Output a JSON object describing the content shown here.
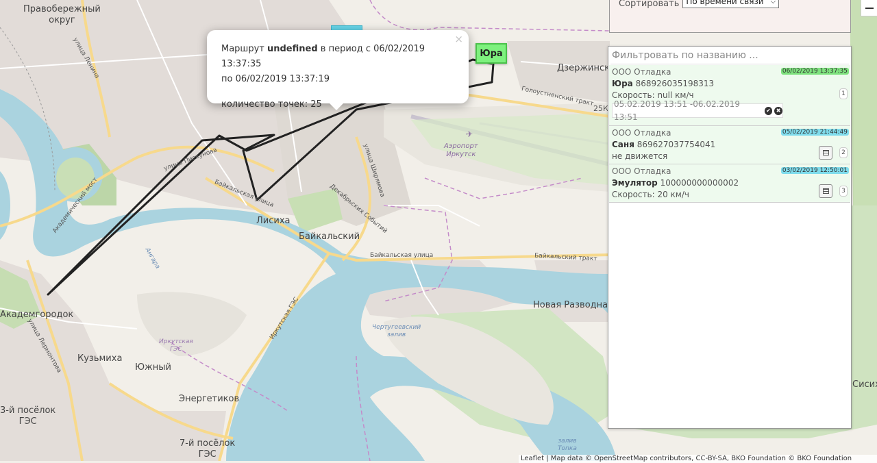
{
  "map": {
    "labels": {
      "pravoberezhny": "Правобережный\nокруг",
      "dzerzhinsk": "Дзержинск",
      "lisikha": "Лисиха",
      "baikalsky": "Байкальский",
      "akademgorodok": "Академгородок",
      "kuzmikha": "Кузьмиха",
      "yuzhny": "Южный",
      "energetikov": "Энергетиков",
      "poselok3": "3-й посёлок\nГЭС",
      "poselok7": "7-й посёлок\nГЭС",
      "novaya_razvodnaya": "Новая Разводная",
      "sisikha": "Сисиха",
      "airport": "Аэропорт\nИркутск",
      "hydro": "Иркутская\nГЭС",
      "chertugeevsky": "Чертугеевский\nзалив",
      "topka": "залив\nТопка",
      "angara": "Ангара",
      "golousnenskiy": "Голоустненский тракт",
      "baikalskaya1": "Байкальская улица",
      "baikalskaya2": "Байкальская улица",
      "baikalsky_trakt": "Байкальский тракт",
      "piskunova": "улица Пискунова",
      "lenina": "улица Ленина",
      "akademicheskiy_most": "Академический мост",
      "shiryamova": "улица Ширямова",
      "dekabrskih": "Декабрьских Событий",
      "lermontova": "улица Лермонтова",
      "irkutskaya_ges": "Иркутская ГЭС",
      "km25": "25К"
    },
    "route_color": "#222222",
    "attribution": "Leaflet | Map data © OpenStreetMap contributors, CC-BY-SA, BKO Foundation © BKO Foundation"
  },
  "popup": {
    "prefix": "Маршрут ",
    "route_name": "undefined",
    "period_text": " в период с 06/02/2019 13:37:35",
    "period_end": "по 06/02/2019 13:37:19",
    "points": "количество точек: 25",
    "close": "×"
  },
  "marker": {
    "label": "Юра",
    "color": "#7ef17e"
  },
  "sort": {
    "label": "Сортировать",
    "selected": "По времени связи"
  },
  "filter": {
    "placeholder": "Фильтровать по названию ..."
  },
  "objects": [
    {
      "org": "ООО Отладка",
      "time": "06/02/2019 13:37:35",
      "time_color": "#7ee27e",
      "name": "Юра",
      "imei": "868926035198313",
      "status": "Скорость: null км/ч",
      "period": "05.02.2019 13:51 -06.02.2019 13:51",
      "num": "1"
    },
    {
      "org": "ООО Отладка",
      "time": "05/02/2019 21:44:49",
      "time_color": "#7fdcec",
      "name": "Саня",
      "imei": "869627037754041",
      "status": "не движется",
      "num": "2"
    },
    {
      "org": "ООО Отладка",
      "time": "03/02/2019 12:50:01",
      "time_color": "#7fdcec",
      "name": "Эмулятор",
      "imei": "100000000000002",
      "status": "Скорость: 20 км/ч",
      "num": "3"
    }
  ]
}
